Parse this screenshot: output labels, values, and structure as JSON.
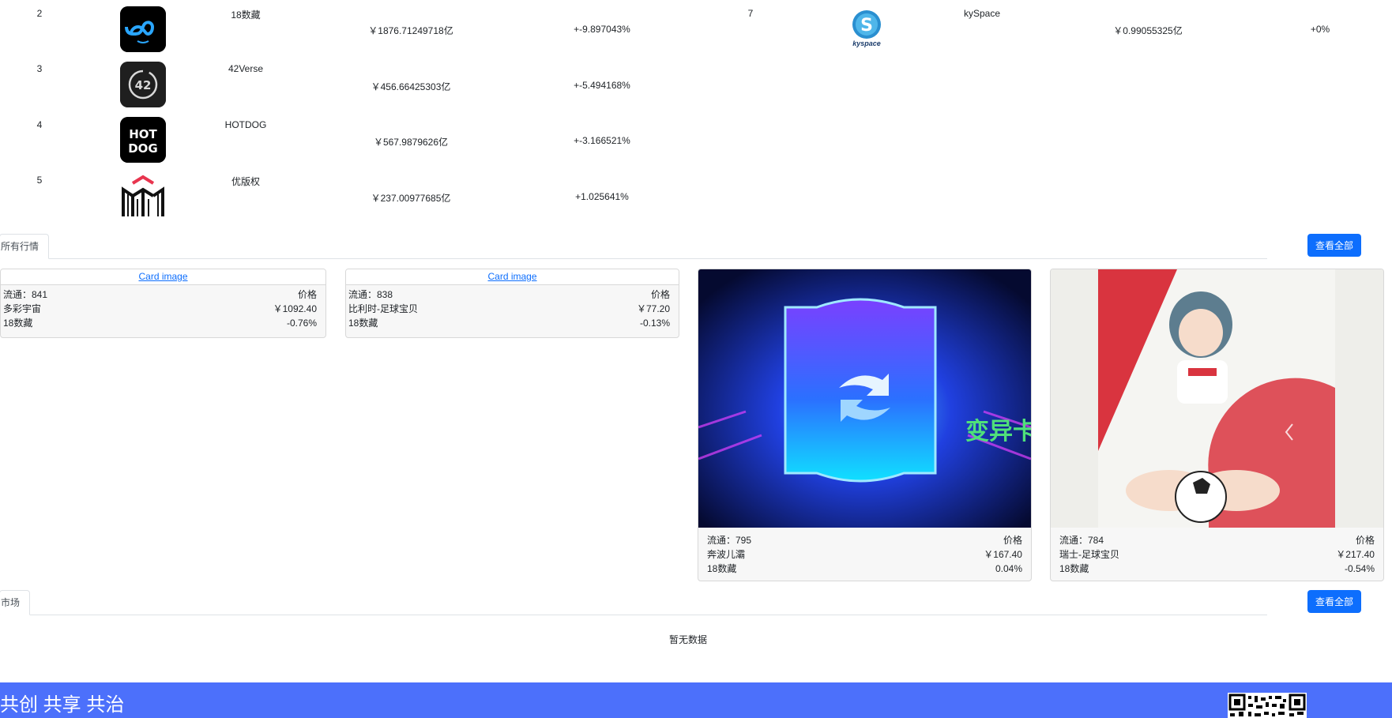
{
  "ranking_left": [
    {
      "rank": "2",
      "name": "18数藏",
      "value": "￥1876.71249718亿",
      "change": "+-9.897043%",
      "icon": "infinity-logo-icon"
    },
    {
      "rank": "3",
      "name": "42Verse",
      "value": "￥456.66425303亿",
      "change": "+-5.494168%",
      "icon": "42-logo-icon"
    },
    {
      "rank": "4",
      "name": "HOTDOG",
      "value": "￥567.9879626亿",
      "change": "+-3.166521%",
      "icon": "hotdog-logo-icon"
    },
    {
      "rank": "5",
      "name": "优版权",
      "value": "￥237.00977685亿",
      "change": "+1.025641%",
      "icon": "m-logo-icon"
    }
  ],
  "ranking_right": [
    {
      "rank": "7",
      "name": "kySpace",
      "value": "￥0.99055325亿",
      "change": "+0%",
      "icon": "kyspace-logo-icon",
      "logo_caption": "kyspace"
    }
  ],
  "sections": {
    "all_market": {
      "tab": "所有行情",
      "view_all": "查看全部"
    },
    "market": {
      "tab": "市场",
      "view_all": "查看全部",
      "empty": "暂无数据"
    }
  },
  "cards": [
    {
      "image_alt": "Card image",
      "circulation": "流通：841",
      "price_label": "价格",
      "name": "多彩宇宙",
      "price": "￥1092.40",
      "platform": "18数藏",
      "change": "-0.76%"
    },
    {
      "image_alt": "Card image",
      "circulation": "流通：838",
      "price_label": "价格",
      "name": "比利时-足球宝贝",
      "price": "￥77.20",
      "platform": "18数藏",
      "change": "-0.13%"
    },
    {
      "image_text": "变异卡",
      "circulation": "流通：795",
      "price_label": "价格",
      "name": "奔波儿灞",
      "price": "￥167.40",
      "platform": "18数藏",
      "change": "0.04%"
    },
    {
      "circulation": "流通：784",
      "price_label": "价格",
      "name": "瑞士-足球宝贝",
      "price": "￥217.40",
      "platform": "18数藏",
      "change": "-0.54%"
    }
  ],
  "footer": {
    "slogan": "共创 共享 共治"
  },
  "colors": {
    "primary": "#0d6efd",
    "footer": "#4c70fb",
    "change_negative": "#212529"
  }
}
